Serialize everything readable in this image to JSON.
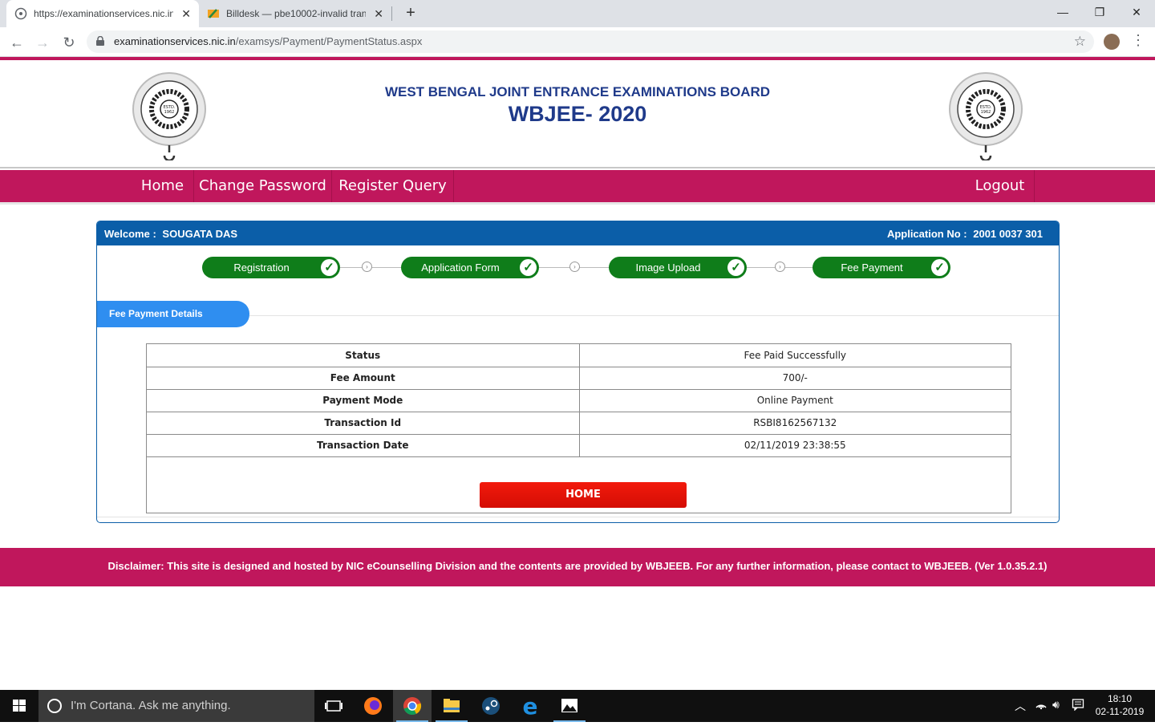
{
  "browser": {
    "tabs": [
      {
        "title": "https://examinationservices.nic.in",
        "active": true
      },
      {
        "title": "Billdesk — pbe10002-invalid tran",
        "active": false
      }
    ],
    "url_host": "examinationservices.nic.in",
    "url_path": "/examsys/Payment/PaymentStatus.aspx"
  },
  "header": {
    "subtitle": "WEST BENGAL JOINT ENTRANCE EXAMINATIONS BOARD",
    "title": "WBJEE- 2020"
  },
  "menu": {
    "home": "Home",
    "change_password": "Change Password",
    "register_query": "Register Query",
    "logout": "Logout"
  },
  "panel": {
    "welcome_label": "Welcome :",
    "candidate_name": "SOUGATA DAS",
    "application_label": "Application No :",
    "application_no": "2001 0037 301"
  },
  "steps": [
    {
      "label": "Registration",
      "done": true
    },
    {
      "label": "Application Form",
      "done": true
    },
    {
      "label": "Image Upload",
      "done": true
    },
    {
      "label": "Fee Payment",
      "done": true
    }
  ],
  "section_title": "Fee Payment Details",
  "details": [
    {
      "key": "Status",
      "value": "Fee Paid Successfully"
    },
    {
      "key": "Fee Amount",
      "value": "700/-"
    },
    {
      "key": "Payment Mode",
      "value": "Online Payment"
    },
    {
      "key": "Transaction Id",
      "value": "RSBI8162567132"
    },
    {
      "key": "Transaction Date",
      "value": "02/11/2019 23:38:55"
    }
  ],
  "home_button": "HOME",
  "footer": "Disclaimer: This site is designed and hosted by NIC eCounselling Division and the contents are provided by WBJEEB. For any further information, please contact to WBJEEB. (Ver 1.0.35.2.1)",
  "taskbar": {
    "search_placeholder": "I'm Cortana. Ask me anything.",
    "time": "18:10",
    "date": "02-11-2019"
  },
  "colors": {
    "brand_magenta": "#c0175c",
    "panel_blue": "#0b5ea8",
    "step_green": "#0f7d1a",
    "button_red": "#e51408",
    "title_navy": "#1f3a8a"
  }
}
